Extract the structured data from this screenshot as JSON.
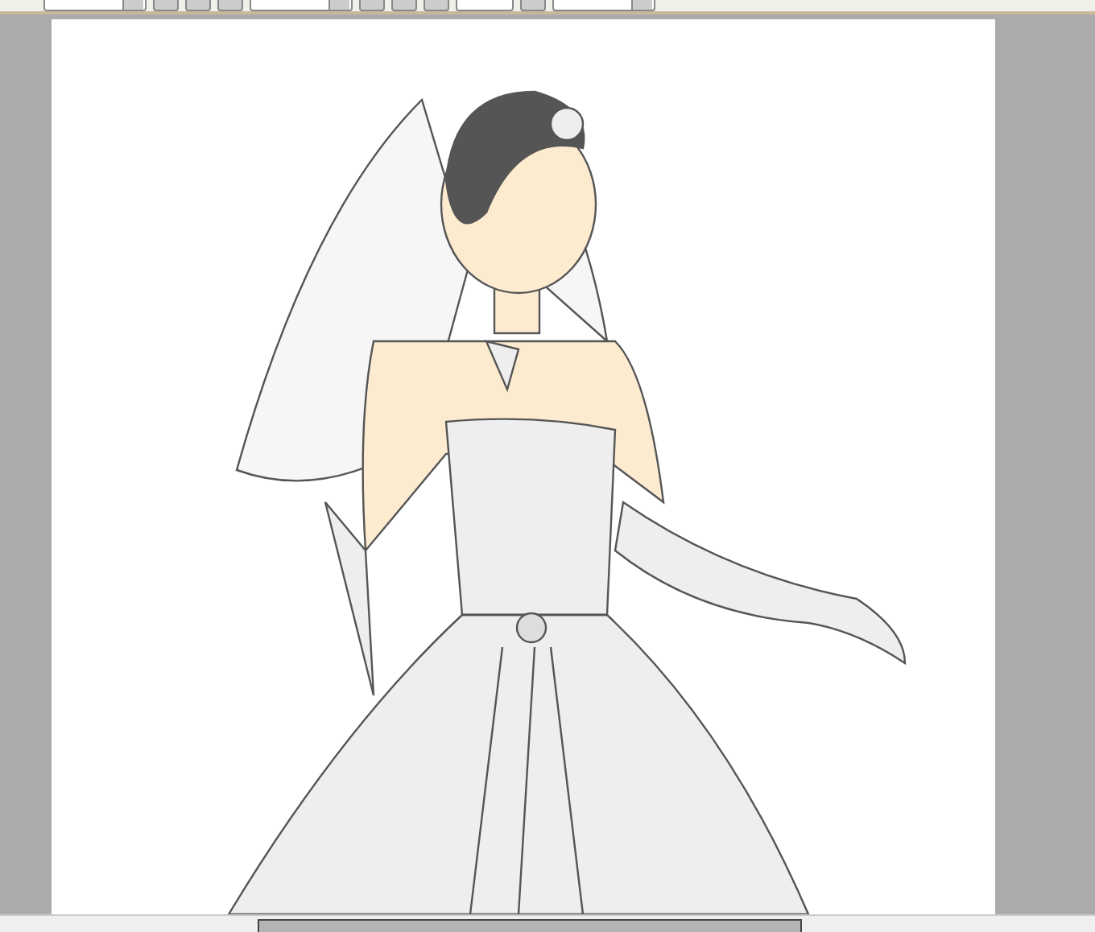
{
  "toolbar": {
    "controls": [
      {
        "kind": "dropdown"
      },
      {
        "kind": "button"
      },
      {
        "kind": "button"
      },
      {
        "kind": "button"
      },
      {
        "kind": "dropdown"
      },
      {
        "kind": "button"
      },
      {
        "kind": "button"
      },
      {
        "kind": "button"
      },
      {
        "kind": "field"
      },
      {
        "kind": "button"
      },
      {
        "kind": "dropdown"
      }
    ]
  },
  "canvas": {
    "artwork": {
      "kind": "illustration"
    }
  }
}
